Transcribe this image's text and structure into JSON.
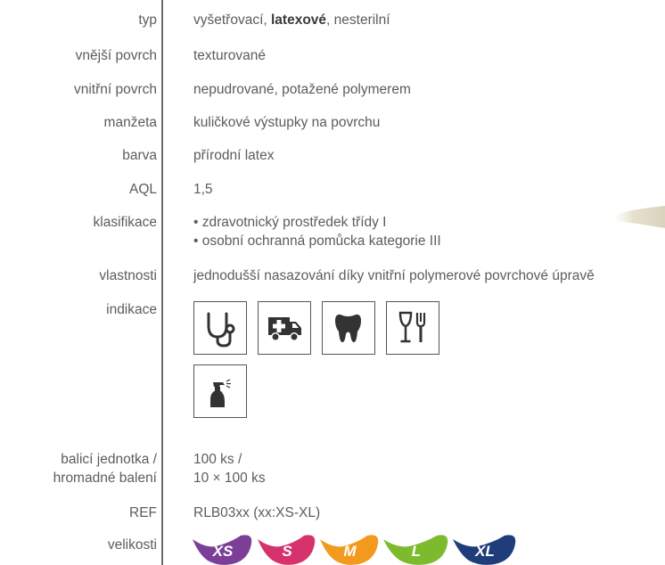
{
  "rows": {
    "typ": {
      "label": "typ",
      "value_pre": "vyšetřovací, ",
      "value_bold": "latexové",
      "value_post": ", nesterilní"
    },
    "outer": {
      "label": "vnější povrch",
      "value": "texturované"
    },
    "inner": {
      "label": "vnitřní povrch",
      "value": "nepudrované, potažené polymerem"
    },
    "cuff": {
      "label": "manžeta",
      "value": "kuličkové výstupky na povrchu"
    },
    "color": {
      "label": "barva",
      "value": "přírodní latex"
    },
    "aql": {
      "label": "AQL",
      "value": "1,5"
    },
    "class": {
      "label": "klasifikace",
      "line1": "• zdravotnický prostředek třídy I",
      "line2": "• osobní ochranná pomůcka kategorie III"
    },
    "props": {
      "label": "vlastnosti",
      "value": "jednodušší nasazování díky vnitřní polymerové povrchové úpravě"
    },
    "indic": {
      "label": "indikace"
    },
    "pack": {
      "label1": "balicí jednotka /",
      "label2": "hromadné balení",
      "value1": "100 ks /",
      "value2": "10 × 100 ks"
    },
    "ref": {
      "label": "REF",
      "value": "RLB03xx (xx:XS-XL)"
    },
    "sizes": {
      "label": "velikosti"
    }
  },
  "indication_icons": [
    "stethoscope-icon",
    "ambulance-icon",
    "tooth-icon",
    "food-service-icon",
    "spray-bottle-icon"
  ],
  "sizes": [
    {
      "label": "XS",
      "color": "#7b3f98"
    },
    {
      "label": "S",
      "color": "#d6336c"
    },
    {
      "label": "M",
      "color": "#f39a1e"
    },
    {
      "label": "L",
      "color": "#7dbb2e"
    },
    {
      "label": "XL",
      "color": "#1f3d7a"
    }
  ]
}
